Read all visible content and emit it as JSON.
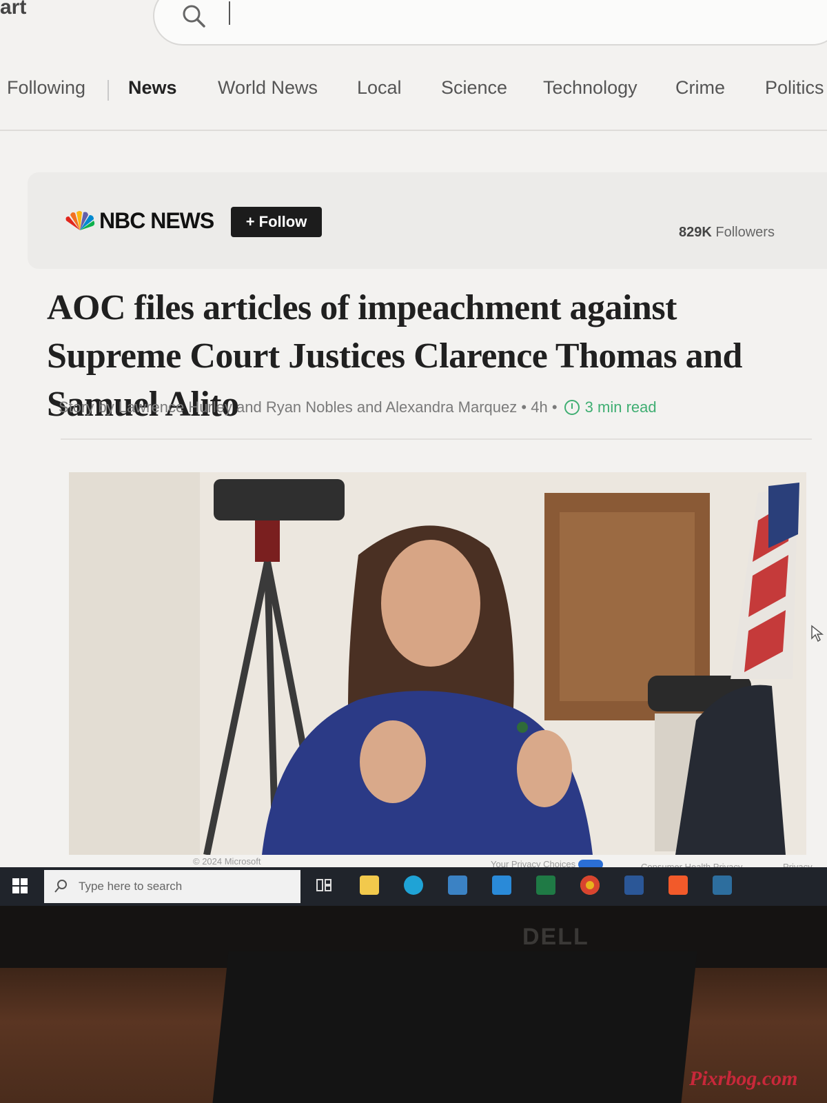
{
  "browser": {
    "brand_fragment": "art",
    "search": {
      "value": "",
      "placeholder": ""
    }
  },
  "nav": {
    "items": [
      {
        "label": "Following"
      },
      {
        "label": "News",
        "active": true
      },
      {
        "label": "World News"
      },
      {
        "label": "Local"
      },
      {
        "label": "Science"
      },
      {
        "label": "Technology"
      },
      {
        "label": "Crime"
      },
      {
        "label": "Politics"
      }
    ]
  },
  "source": {
    "name": "NBC NEWS",
    "follow_label": "+ Follow",
    "followers_count": "829K",
    "followers_label": "Followers"
  },
  "article": {
    "headline": "AOC files articles of impeachment against Supreme Court Justices Clarence Thomas and Samuel Alito",
    "byline": "Story by Lawrence Hurley and Ryan Nobles and Alexandra Marquez",
    "age": "4h",
    "read_time": "3 min read"
  },
  "footer": {
    "copyright": "© 2024 Microsoft",
    "privacy_choices": "Your Privacy Choices",
    "health_privacy": "Consumer Health Privacy",
    "privacy_more": "Privacy"
  },
  "taskbar": {
    "search_placeholder": "Type here to search",
    "apps": [
      "task-view-icon",
      "file-explorer-icon",
      "edge-icon",
      "store-icon",
      "mail-icon",
      "excel-icon",
      "chrome-icon",
      "word-icon",
      "brave-icon",
      "solitaire-icon"
    ]
  },
  "monitor": {
    "brand": "DELL"
  },
  "watermark": "Pixrbog.com",
  "colors": {
    "accent_green": "#3fae72",
    "follow_button": "#1c1c1c",
    "taskbar": "#20242b"
  }
}
